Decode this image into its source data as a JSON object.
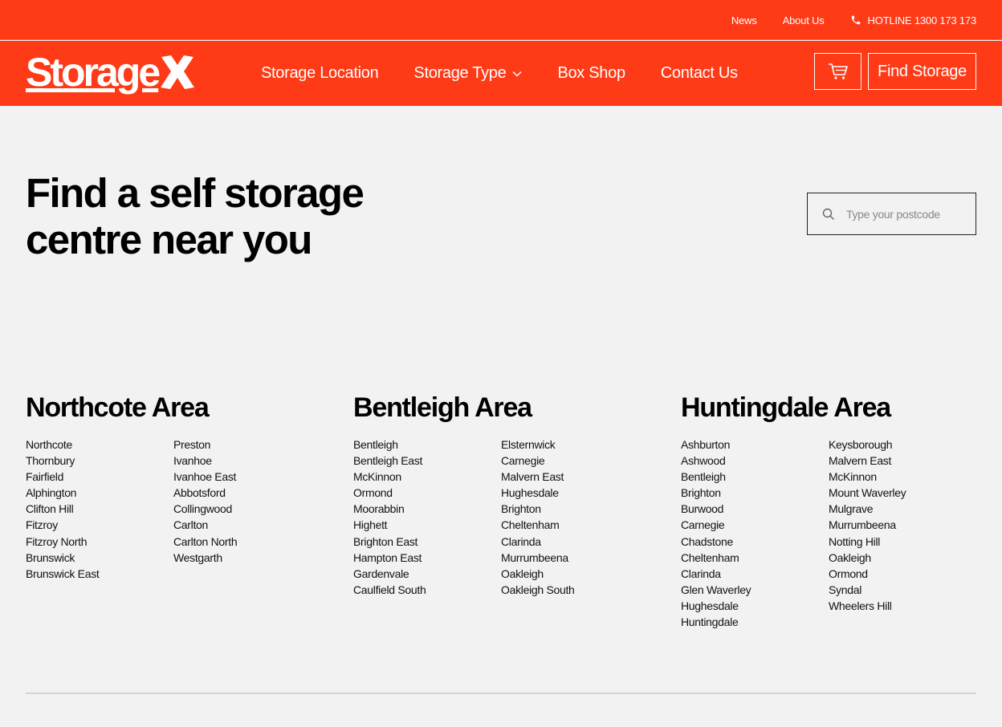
{
  "topbar": {
    "news": "News",
    "about": "About Us",
    "hotline": "HOTLINE 1300 173 173"
  },
  "header": {
    "logo_text": "Storage",
    "nav": {
      "location": "Storage Location",
      "type": "Storage Type",
      "box_shop": "Box Shop",
      "contact": "Contact Us"
    },
    "find_storage": "Find Storage"
  },
  "hero": {
    "title_line1": "Find a self storage",
    "title_line2": "centre near you"
  },
  "search": {
    "placeholder": "Type your postcode"
  },
  "areas": [
    {
      "title": "Northcote Area",
      "col1": [
        "Northcote",
        "Thornbury",
        "Fairfield",
        "Alphington",
        "Clifton Hill",
        "Fitzroy",
        "Fitzroy North",
        "Brunswick",
        "Brunswick East"
      ],
      "col2": [
        "Preston",
        "Ivanhoe",
        "Ivanhoe East",
        "Abbotsford",
        "Collingwood",
        "Carlton",
        "Carlton North",
        "Westgarth"
      ]
    },
    {
      "title": "Bentleigh Area",
      "col1": [
        "Bentleigh",
        "Bentleigh East",
        "McKinnon",
        "Ormond",
        "Moorabbin",
        "Highett",
        "Brighton East",
        "Hampton East",
        "Gardenvale",
        "Caulfield South"
      ],
      "col2": [
        "Elsternwick",
        "Carnegie",
        "Malvern East",
        "Hughesdale",
        "Brighton",
        "Cheltenham",
        "Clarinda",
        "Murrumbeena",
        "Oakleigh",
        "Oakleigh South"
      ]
    },
    {
      "title": "Huntingdale Area",
      "col1": [
        "Ashburton",
        "Ashwood",
        "Bentleigh",
        "Brighton",
        "Burwood",
        "Carnegie",
        "Chadstone",
        "Cheltenham",
        "Clarinda",
        "Glen Waverley",
        "Hughesdale",
        "Huntingdale"
      ],
      "col2": [
        "Keysborough",
        "Malvern East",
        "McKinnon",
        "Mount Waverley",
        "Mulgrave",
        "Murrumbeena",
        "Notting Hill",
        "Oakleigh",
        "Ormond",
        "Syndal",
        "Wheelers Hill"
      ]
    }
  ],
  "colors": {
    "brand": "#ff3a17",
    "background": "#f2f2f2"
  }
}
